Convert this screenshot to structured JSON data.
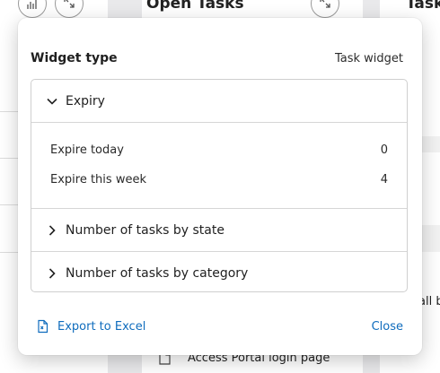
{
  "background": {
    "card_title": "Open Tasks",
    "card_title_right": "Tasks",
    "right_text": "all b",
    "list_item": "Access Portal login page",
    "icons": [
      "chart-icon",
      "expand-icon",
      "collapse-icon"
    ]
  },
  "popup": {
    "widget_type_label": "Widget type",
    "widget_type_value": "Task widget",
    "sections": [
      {
        "label": "Expiry",
        "expanded": true,
        "rows": [
          {
            "label": "Expire today",
            "value": "0"
          },
          {
            "label": "Expire this week",
            "value": "4"
          }
        ]
      },
      {
        "label": "Number of tasks by state",
        "expanded": false
      },
      {
        "label": "Number of tasks by category",
        "expanded": false
      }
    ],
    "export_label": "Export to Excel",
    "close_label": "Close"
  },
  "colors": {
    "link": "#0f6cbd",
    "border": "#cfcfcf",
    "background": "#e9e9eb"
  }
}
